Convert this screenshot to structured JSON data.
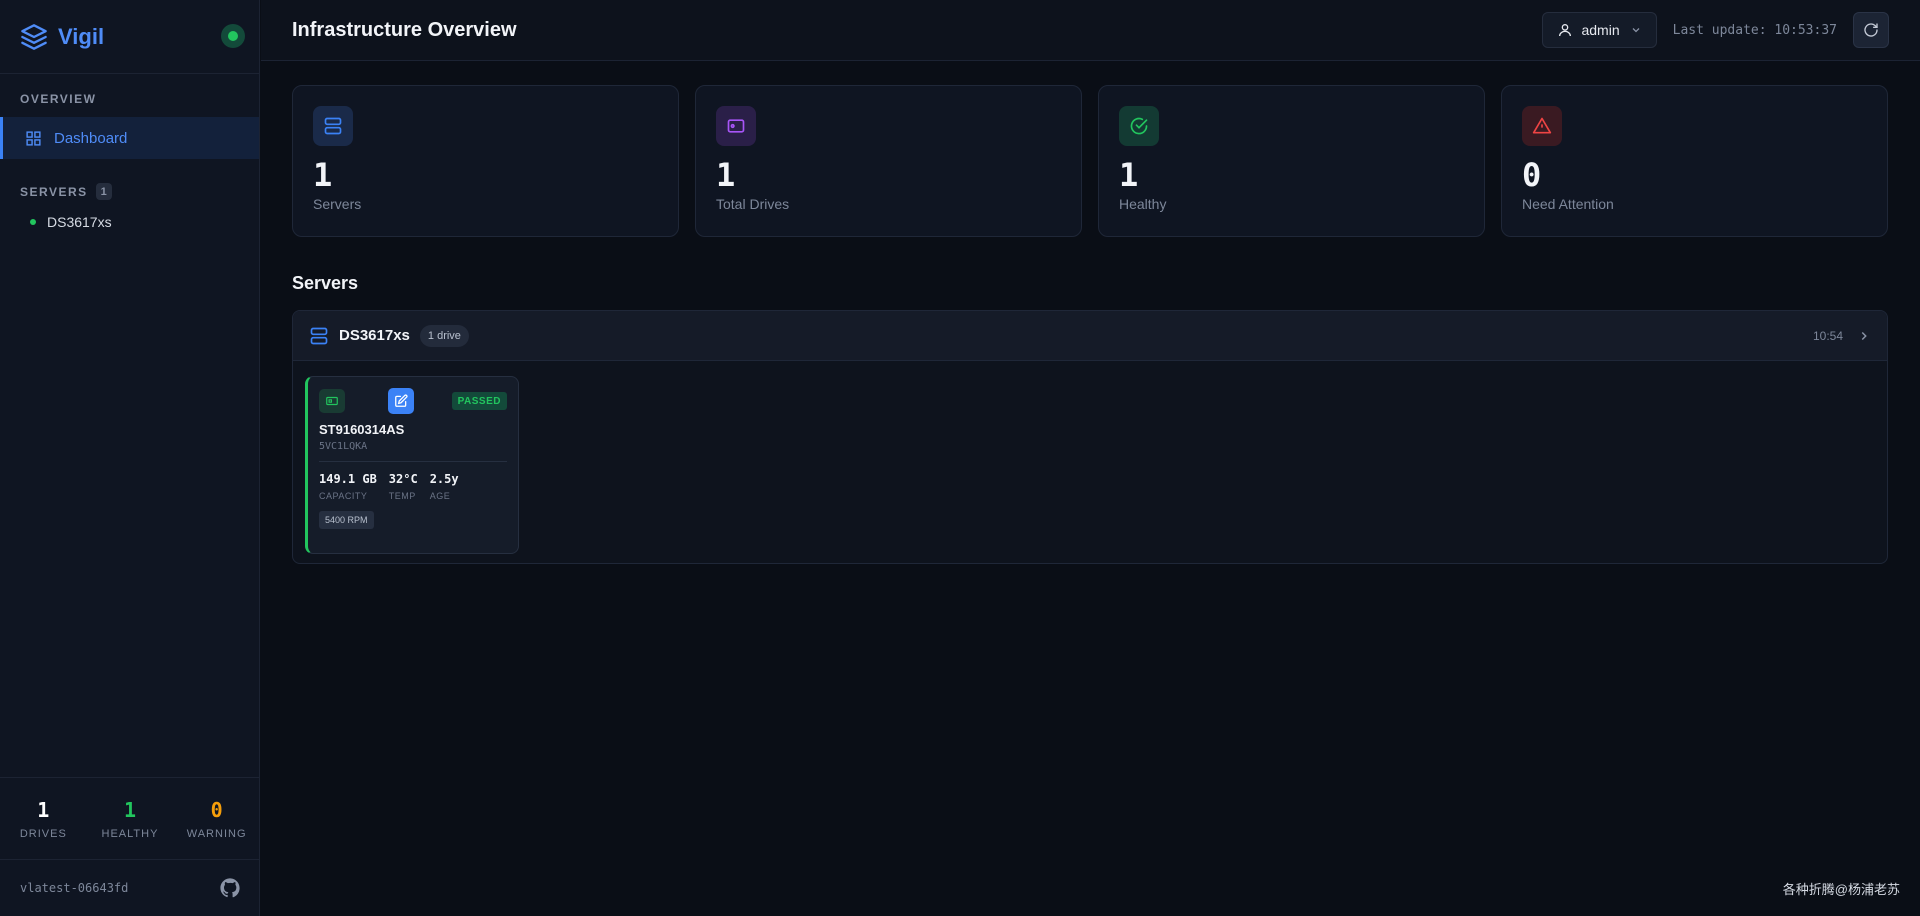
{
  "sidebar": {
    "brand": "Vigil",
    "overview_label": "OVERVIEW",
    "nav": [
      {
        "label": "Dashboard"
      }
    ],
    "servers_label": "SERVERS",
    "servers_count": "1",
    "servers": [
      {
        "name": "DS3617xs"
      }
    ],
    "stats": [
      {
        "value": "1",
        "label": "DRIVES",
        "color": "#ffffff"
      },
      {
        "value": "1",
        "label": "HEALTHY",
        "color": "#22c55e"
      },
      {
        "value": "0",
        "label": "WARNING",
        "color": "#f59e0b"
      }
    ],
    "version": "vlatest-06643fd"
  },
  "header": {
    "title": "Infrastructure Overview",
    "user": "admin",
    "last_update": "Last update: 10:53:37"
  },
  "cards": [
    {
      "value": "1",
      "label": "Servers",
      "icon": "server-icon",
      "color": "#3b82f6"
    },
    {
      "value": "1",
      "label": "Total Drives",
      "icon": "drive-icon",
      "color": "#a855f7"
    },
    {
      "value": "1",
      "label": "Healthy",
      "icon": "check-circle-icon",
      "color": "#22c55e"
    },
    {
      "value": "0",
      "label": "Need Attention",
      "icon": "warning-icon",
      "color": "#ef4444"
    }
  ],
  "servers_section": {
    "title": "Servers",
    "server": {
      "name": "DS3617xs",
      "drive_count": "1 drive",
      "time": "10:54",
      "drives": [
        {
          "status": "PASSED",
          "model": "ST9160314AS",
          "serial": "5VC1LQKA",
          "capacity": "149.1 GB",
          "capacity_label": "CAPACITY",
          "temp": "32°C",
          "temp_label": "TEMP",
          "age": "2.5y",
          "age_label": "AGE",
          "rpm": "5400 RPM"
        }
      ]
    }
  },
  "watermark": "各种折腾@杨浦老苏"
}
